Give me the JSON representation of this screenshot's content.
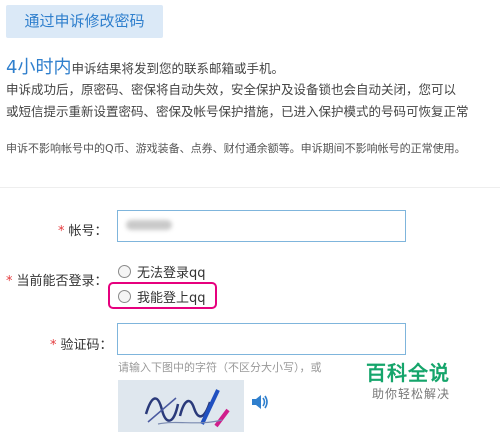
{
  "header": {
    "tab_label": "通过申诉修改密码"
  },
  "info": {
    "hours": "4小时内",
    "line1_rest": "申诉结果将发到您的联系邮箱或手机。",
    "line2": "申诉成功后，原密码、密保将自动失效，安全保护及设备锁也会自动关闭，您可以",
    "line3": "或短信提示重新设置密码、密保及帐号保护措施，已进入保护模式的号码可恢复正常",
    "note": "申诉不影响帐号中的Q币、游戏装备、点券、财付通余额等。申诉期间不影响帐号的正常使用。"
  },
  "form": {
    "required_mark": "*",
    "account_label": "帐号：",
    "login_label": "当前能否登录：",
    "option_cannot": "无法登录qq",
    "option_can": "我能登上qq",
    "captcha_label": "验证码：",
    "captcha_hint": "请输入下图中的字符（不区分大小写），或"
  },
  "watermark": {
    "title": "百科全说",
    "subtitle": "助你轻松解决"
  },
  "colors": {
    "accent": "#2f7fcd",
    "highlight": "#e6007e",
    "required": "#e4393c",
    "brand_green": "#15a56b"
  }
}
